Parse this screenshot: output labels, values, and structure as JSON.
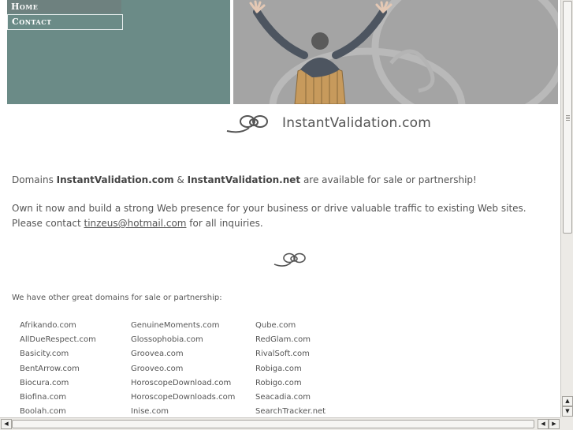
{
  "nav": {
    "home": "Home",
    "contact": "Contact"
  },
  "logo": {
    "text": "InstantValidation.com"
  },
  "intro": {
    "prefix": "Domains ",
    "domain1": "InstantValidation.com",
    "amp": " & ",
    "domain2": "InstantValidation.net",
    "suffix": " are available for sale or partnership!"
  },
  "pitch": {
    "text": "Own it now and build a strong Web presence for your business or drive valuable traffic to existing Web sites.  Please contact ",
    "email": "tinzeus@hotmail.com",
    "suffix": " for all inquiries."
  },
  "other": {
    "heading": "We have other great domains for sale or partnership:",
    "col1": [
      "Afrikando.com",
      "AllDueRespect.com",
      "Basicity.com",
      "BentArrow.com",
      "Biocura.com",
      "Biofina.com",
      "Boolah.com"
    ],
    "col2": [
      "GenuineMoments.com",
      "Glossophobia.com",
      "Groovea.com",
      "Grooveo.com",
      "HoroscopeDownload.com",
      "HoroscopeDownloads.com",
      "Inise.com"
    ],
    "col3": [
      "Qube.com",
      "RedGlam.com",
      "RivalSoft.com",
      "Robiga.com",
      "Robigo.com",
      "Seacadia.com",
      "SearchTracker.net"
    ]
  },
  "colors": {
    "nav_bg": "#6b8b87",
    "hero_bg": "#a3a3a3",
    "text": "#555555"
  },
  "icons": [
    "logo-swirl-icon",
    "divider-swirl-icon",
    "scroll-up-icon",
    "scroll-down-icon",
    "scroll-left-icon",
    "scroll-right-icon"
  ]
}
